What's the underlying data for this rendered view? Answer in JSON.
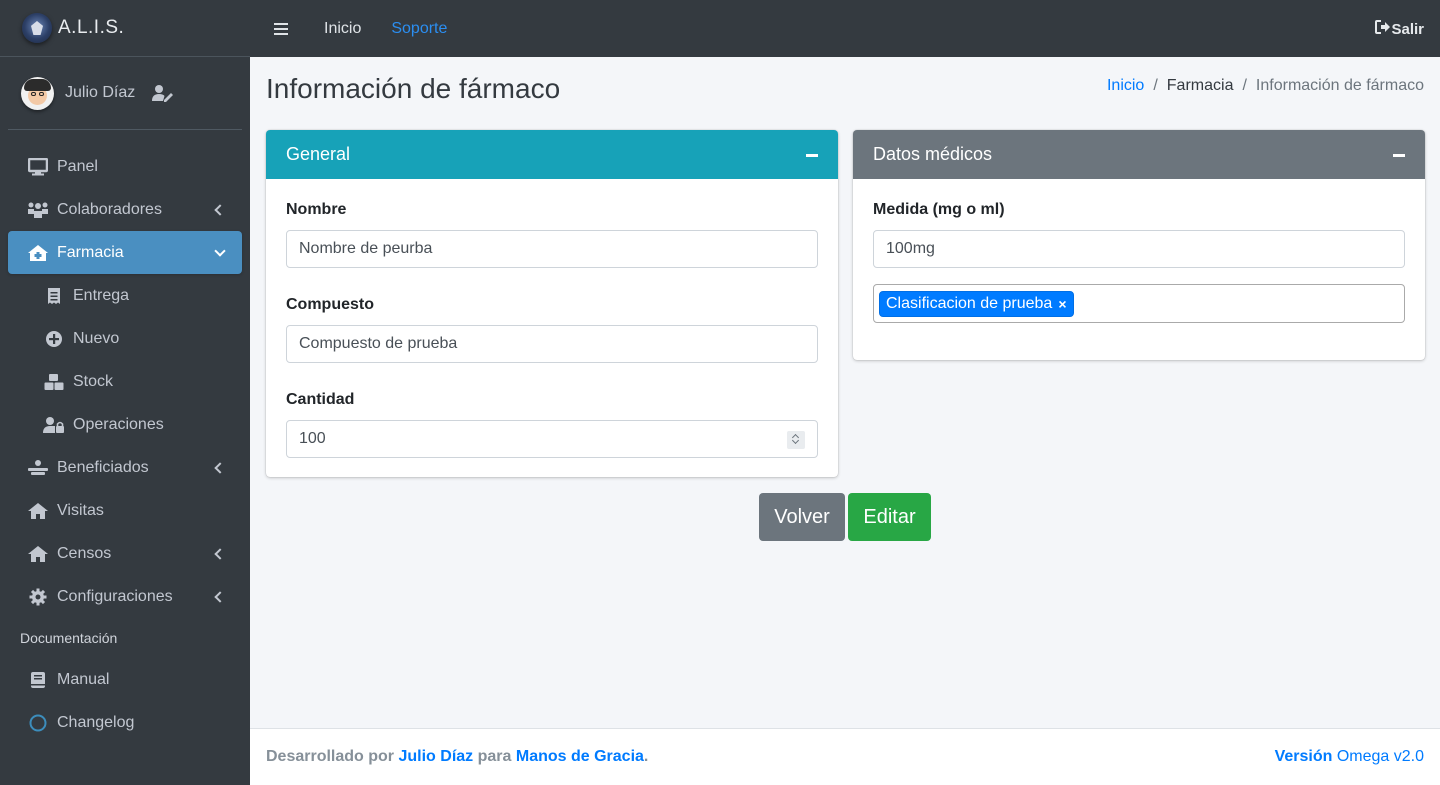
{
  "brand": {
    "name": "A.L.I.S."
  },
  "user": {
    "name": "Julio Díaz"
  },
  "sidebar": {
    "items": [
      {
        "label": "Panel",
        "icon": "desktop-icon"
      },
      {
        "label": "Colaboradores",
        "icon": "users-icon"
      },
      {
        "label": "Farmacia",
        "icon": "clinic-house-icon"
      },
      {
        "label": "Entrega",
        "icon": "receipt-icon"
      },
      {
        "label": "Nuevo",
        "icon": "plus-circle-icon"
      },
      {
        "label": "Stock",
        "icon": "boxes-icon"
      },
      {
        "label": "Operaciones",
        "icon": "user-lock-icon"
      },
      {
        "label": "Beneficiados",
        "icon": "person-bed-icon"
      },
      {
        "label": "Visitas",
        "icon": "house-icon"
      },
      {
        "label": "Censos",
        "icon": "house-icon"
      },
      {
        "label": "Configuraciones",
        "icon": "gear-icon"
      }
    ],
    "doc_header": "Documentación",
    "doc_items": [
      {
        "label": "Manual",
        "icon": "book-icon"
      },
      {
        "label": "Changelog",
        "icon": "circle-icon"
      }
    ]
  },
  "topbar": {
    "home": "Inicio",
    "support": "Soporte",
    "logout": "Salir"
  },
  "page": {
    "title": "Información de fármaco"
  },
  "breadcrumb": {
    "home": "Inicio",
    "section": "Farmacia",
    "current": "Información de fármaco"
  },
  "general": {
    "title": "General",
    "name_label": "Nombre",
    "name_value": "Nombre de peurba",
    "compound_label": "Compuesto",
    "compound_value": "Compuesto de prueba",
    "qty_label": "Cantidad",
    "qty_value": "100"
  },
  "medical": {
    "title": "Datos médicos",
    "measure_label": "Medida (mg o ml)",
    "measure_value": "100mg",
    "tag": "Clasificacion de prueba",
    "tag_remove": "×"
  },
  "buttons": {
    "back": "Volver",
    "edit": "Editar"
  },
  "footer": {
    "dev_prefix": "Desarrollado por",
    "dev_name": "Julio Díaz",
    "mid": "para",
    "org": "Manos de Gracia",
    "dot": ".",
    "version_label": "Versión",
    "version_value": "Omega v2.0"
  },
  "colors": {
    "sidebar": "#343a40",
    "active": "#4a8fc1",
    "info_header": "#17a2b8",
    "secondary_header": "#6c757d",
    "success": "#28a745",
    "primary": "#007bff"
  }
}
